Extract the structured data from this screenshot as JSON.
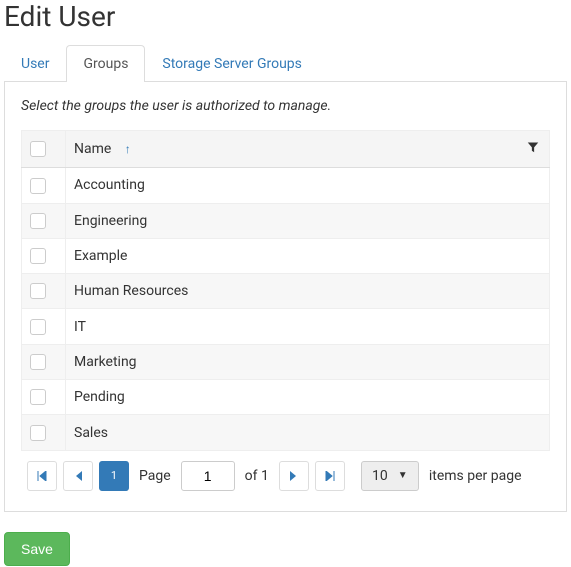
{
  "page": {
    "title": "Edit User"
  },
  "tabs": {
    "user": "User",
    "groups": "Groups",
    "storage": "Storage Server Groups",
    "active": "groups"
  },
  "instruction": "Select the groups the user is authorized to manage.",
  "table": {
    "header": {
      "name": "Name"
    },
    "rows": [
      {
        "name": "Accounting"
      },
      {
        "name": "Engineering"
      },
      {
        "name": "Example"
      },
      {
        "name": "Human Resources"
      },
      {
        "name": "IT"
      },
      {
        "name": "Marketing"
      },
      {
        "name": "Pending"
      },
      {
        "name": "Sales"
      }
    ]
  },
  "pager": {
    "current": "1",
    "page_label": "Page",
    "page_input": "1",
    "of_label": "of 1",
    "page_size": "10",
    "per_page_label": "items per page"
  },
  "icons": {
    "sort_up": "↑",
    "filter": "▼",
    "first": "|◄",
    "prev": "◄",
    "next": "►",
    "last": "►|",
    "caret_down": "▼"
  },
  "actions": {
    "save": "Save"
  }
}
